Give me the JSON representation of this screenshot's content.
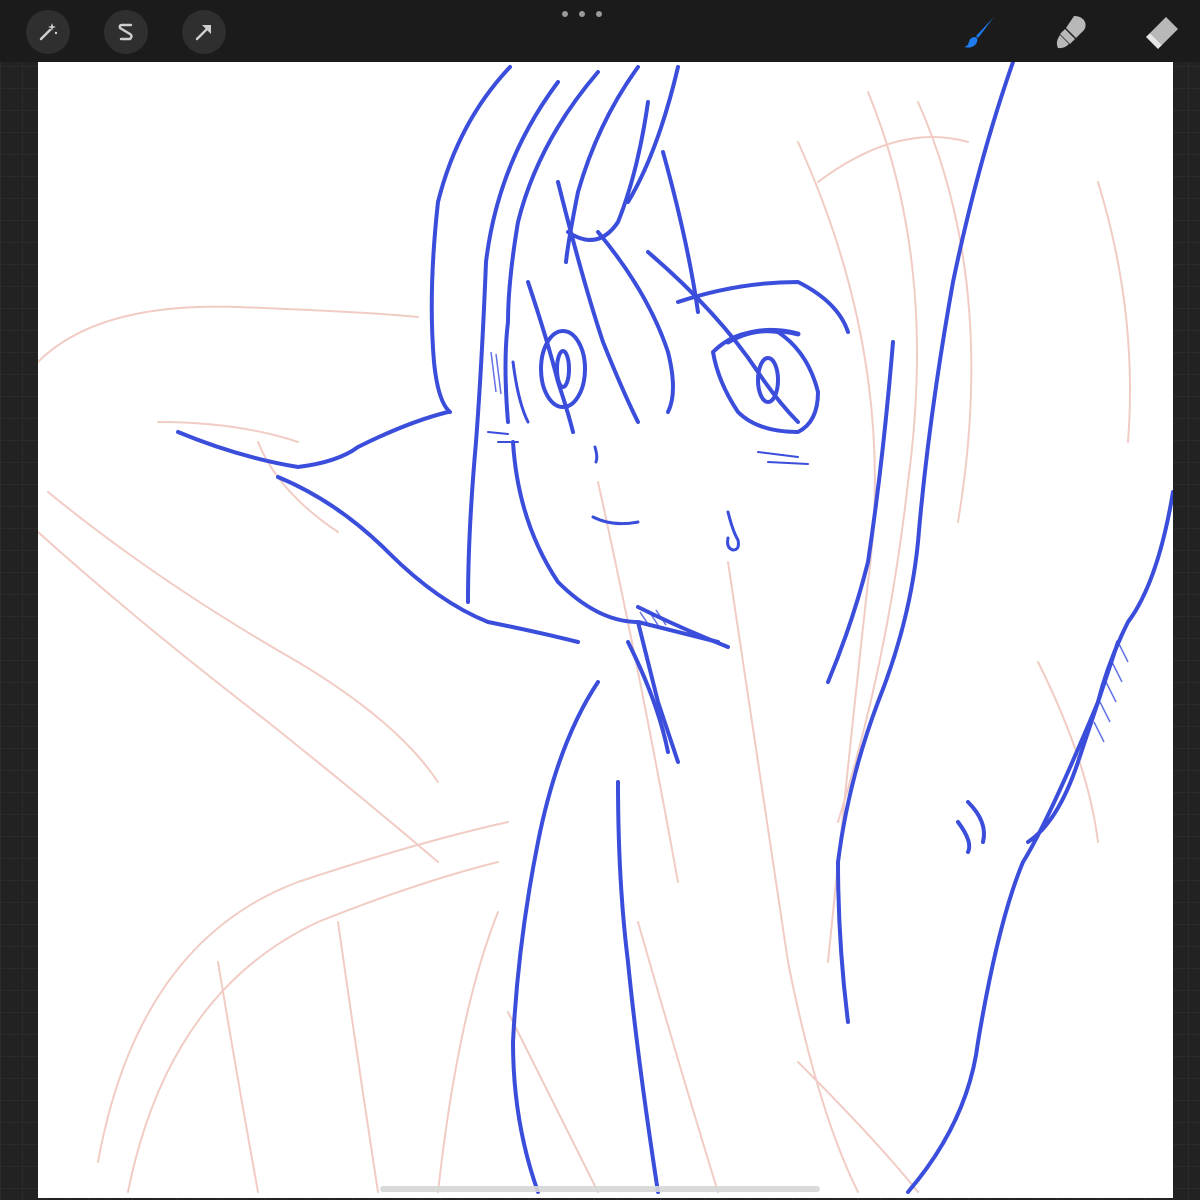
{
  "toolbar": {
    "left_tools": [
      {
        "name": "adjustments",
        "icon": "magic-wand-icon"
      },
      {
        "name": "selection",
        "icon": "selection-s-icon"
      },
      {
        "name": "transform",
        "icon": "arrow-cursor-icon"
      }
    ],
    "right_tools": [
      {
        "name": "brush",
        "icon": "brush-icon",
        "active": true
      },
      {
        "name": "smudge",
        "icon": "smudge-icon",
        "active": false
      },
      {
        "name": "eraser",
        "icon": "eraser-icon",
        "active": false
      }
    ],
    "more_menu_icon": "more-dots-icon"
  },
  "colors": {
    "toolbar_bg": "#1b1b1b",
    "active_tool": "#1e7bf0",
    "inactive_tool": "#b8b8b8",
    "ink": "#3a4ddb",
    "sketch": "#f0c7bf",
    "canvas_bg": "#ffffff"
  }
}
